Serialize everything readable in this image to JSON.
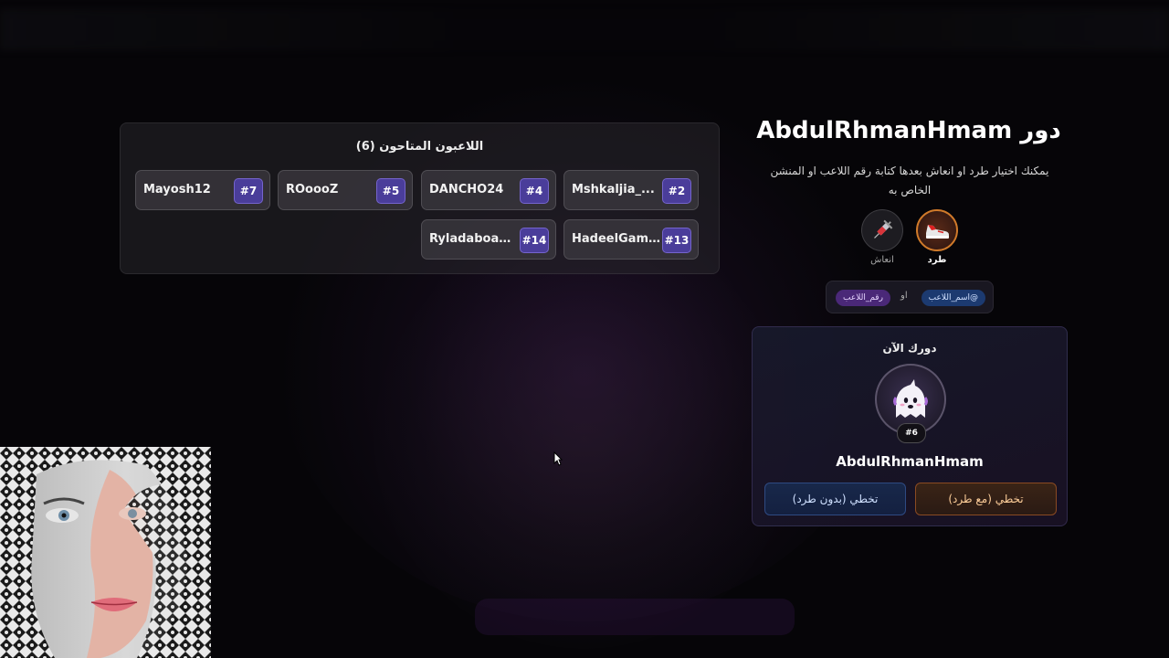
{
  "players_panel": {
    "title": "اللاعبون المتاحون (6)",
    "players": [
      {
        "name": "Mshkaljia_...",
        "number": "#2"
      },
      {
        "name": "DANCHO24",
        "number": "#4"
      },
      {
        "name": "ROoooZ",
        "number": "#5"
      },
      {
        "name": "Mayosh12",
        "number": "#7"
      },
      {
        "name": "HadeelGami...",
        "number": "#13"
      },
      {
        "name": "Ryladaboam...",
        "number": "#14"
      }
    ]
  },
  "turn": {
    "title": "دور AbdulRhmanHmam",
    "description": "يمكنك اختيار طرد او انعاش بعدها كتابة رقم اللاعب او المنشن الخاص به",
    "actions": {
      "kick_label": "طرد",
      "revive_label": "انعاش"
    },
    "hint": {
      "mention_pill": "@اسم_اللاعب",
      "or_text": "او",
      "number_pill": "رقم_اللاعب"
    }
  },
  "current_turn": {
    "label": "دورك الآن",
    "player_name": "AbdulRhmanHmam",
    "player_number": "#6",
    "skip_with_kick_label": "تخطي (مع طرد)",
    "skip_without_kick_label": "تخطي (بدون طرد)"
  },
  "colors": {
    "accent_purple": "#4a3d9a",
    "kick_orange": "#d07a2a",
    "mention_blue": "#1c3a70",
    "number_purple": "#4a2878"
  },
  "icons": {
    "kick": "sneaker-icon",
    "revive": "syringe-icon",
    "avatar": "ghost-icon"
  }
}
